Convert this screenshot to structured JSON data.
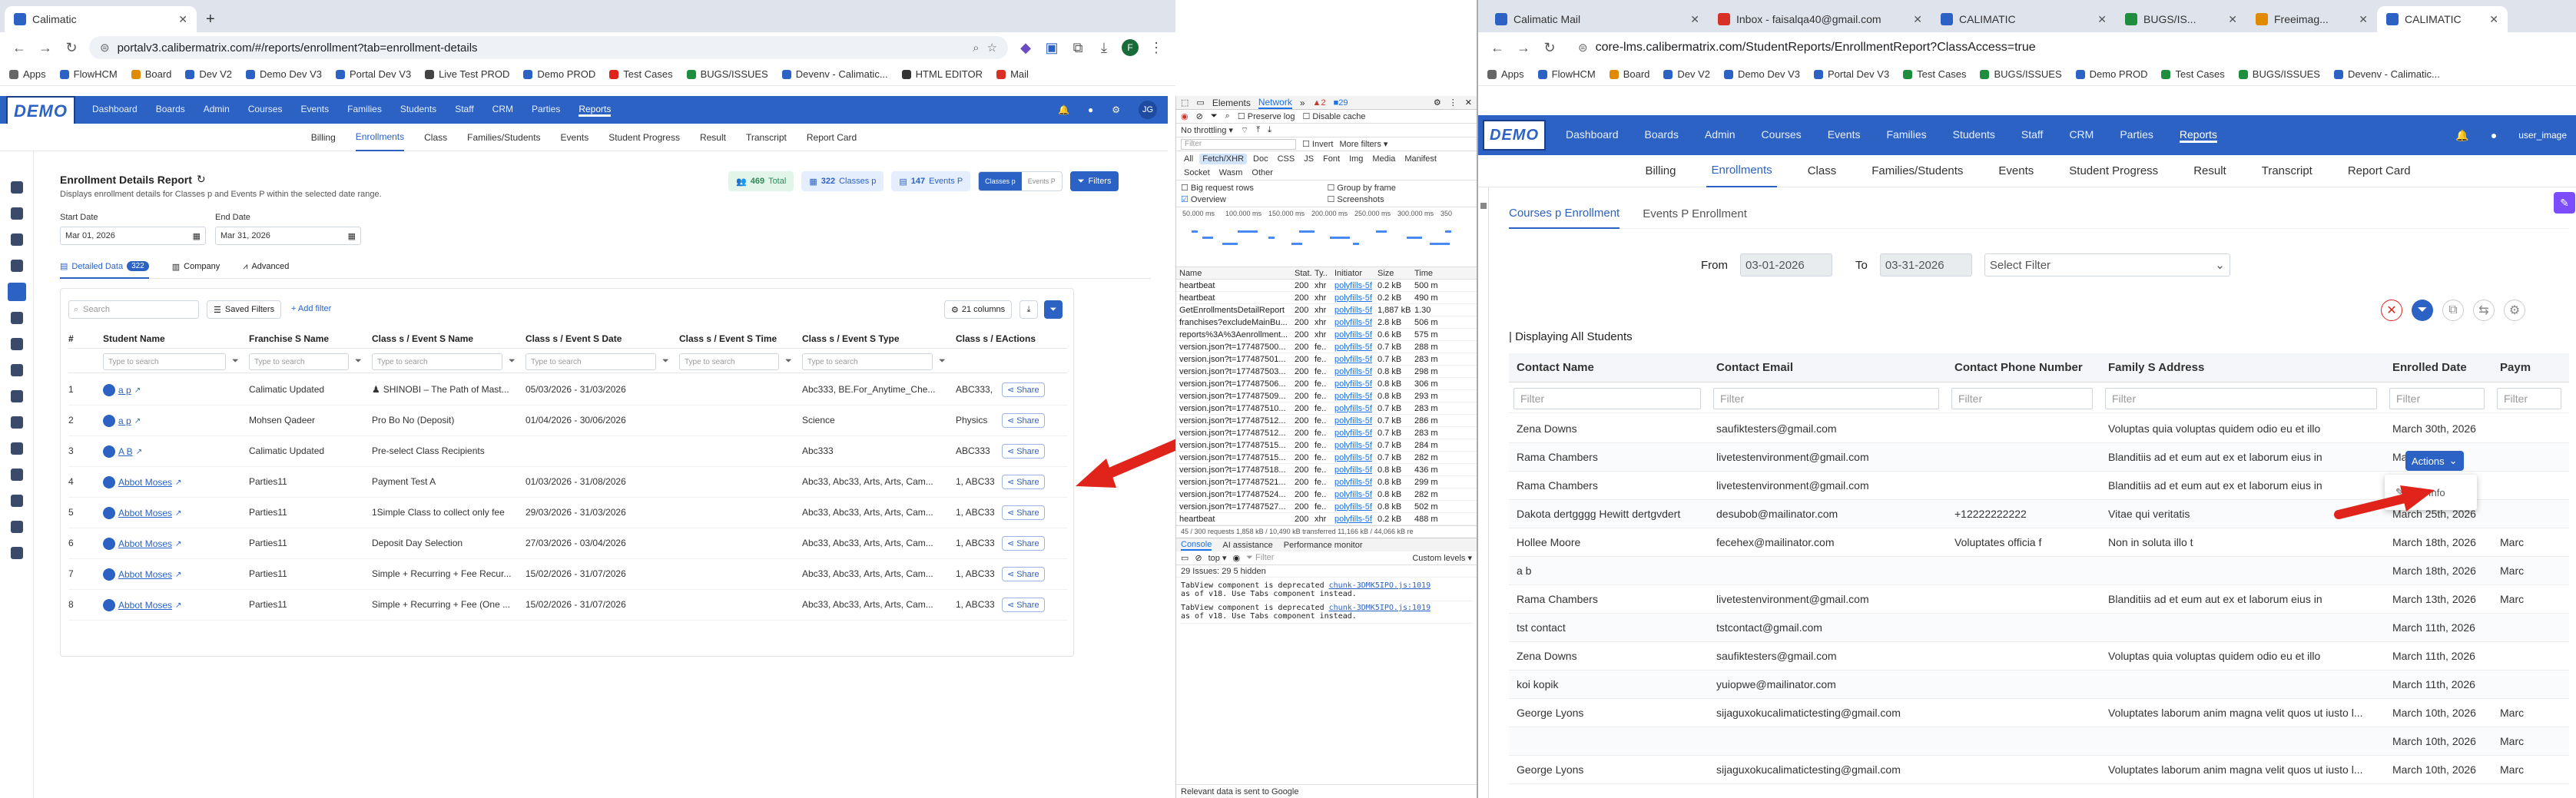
{
  "left_browser": {
    "tab_title": "Calimatic",
    "url": "portalv3.calibermatrix.com/#/reports/enrollment?tab=enrollment-details",
    "bookmarks": [
      "Apps",
      "FlowHCM",
      "Board",
      "Dev V2",
      "Demo Dev V3",
      "Portal Dev V3",
      "Live Test PROD",
      "Demo PROD",
      "Test Cases",
      "BUGS/ISSUES",
      "Devenv - Calimatic...",
      "HTML EDITOR",
      "Mail"
    ]
  },
  "left_app": {
    "logo": "DEMO",
    "nav": [
      "Dashboard",
      "Boards",
      "Admin",
      "Courses",
      "Events",
      "Families",
      "Students",
      "Staff",
      "CRM",
      "Parties",
      "Reports"
    ],
    "avatar": "JG",
    "subnav": [
      "Billing",
      "Enrollments",
      "Class",
      "Families/Students",
      "Events",
      "Student Progress",
      "Result",
      "Transcript",
      "Report Card"
    ],
    "report_title": "Enrollment Details Report",
    "report_desc": "Displays enrollment details for Classes p and Events P within the selected date range.",
    "badges": {
      "total": "469",
      "total_label": "Total",
      "classes": "322",
      "classes_label": "Classes p",
      "events": "147",
      "events_label": "Events P"
    },
    "toggle": {
      "classes": "Classes p",
      "events": "Events P"
    },
    "filters_label": "Filters",
    "start_date_label": "Start Date",
    "start_date": "Mar 01, 2026",
    "end_date_label": "End Date",
    "end_date": "Mar 31, 2026",
    "tabs": {
      "detailed": "Detailed Data",
      "detailed_count": "322",
      "company": "Company",
      "advanced": "Advanced"
    },
    "search_placeholder": "Search",
    "saved_filters": "Saved Filters",
    "add_filter": "+ Add filter",
    "columns_count": "21 columns",
    "columns": [
      "#",
      "Student Name",
      "Franchise S Name",
      "Class s / Event S Name",
      "Class s / Event S Date",
      "Class s / Event S Time",
      "Class s / Event S Type",
      "Class s / E",
      "Actions"
    ],
    "type_to_search": "Type to search",
    "share": "Share",
    "rows": [
      {
        "n": "1",
        "name": "a p",
        "fr": "Calimatic Updated",
        "ev": "SHINOBI – The Path of Mast...",
        "date": "05/03/2026 - 31/03/2026",
        "time": "",
        "type": "Abc333, BE.For_Anytime_Che...",
        "cls": "ABC333,"
      },
      {
        "n": "2",
        "name": "a p",
        "fr": "Mohsen Qadeer",
        "ev": "Pro Bo No (Deposit)",
        "date": "01/04/2026 - 30/06/2026",
        "time": "",
        "type": "Science",
        "cls": "Physics"
      },
      {
        "n": "3",
        "name": "A B",
        "fr": "Calimatic Updated",
        "ev": "Pre-select Class Recipients",
        "date": "",
        "time": "",
        "type": "Abc333",
        "cls": "ABC333"
      },
      {
        "n": "4",
        "name": "Abbot Moses",
        "fr": "Parties11",
        "ev": "Payment Test A",
        "date": "01/03/2026 - 31/08/2026",
        "time": "",
        "type": "Abc33, Abc33, Arts, Arts, Cam...",
        "cls": "1, ABC33,"
      },
      {
        "n": "5",
        "name": "Abbot Moses",
        "fr": "Parties11",
        "ev": "1Simple Class to collect only fee",
        "date": "29/03/2026 - 31/03/2026",
        "time": "",
        "type": "Abc33, Abc33, Arts, Arts, Cam...",
        "cls": "1, ABC33,"
      },
      {
        "n": "6",
        "name": "Abbot Moses",
        "fr": "Parties11",
        "ev": "Deposit Day Selection",
        "date": "27/03/2026 - 03/04/2026",
        "time": "",
        "type": "Abc33, Abc33, Arts, Arts, Cam...",
        "cls": "1, ABC33,"
      },
      {
        "n": "7",
        "name": "Abbot Moses",
        "fr": "Parties11",
        "ev": "Simple + Recurring + Fee Recur...",
        "date": "15/02/2026 - 31/07/2026",
        "time": "",
        "type": "Abc33, Abc33, Arts, Arts, Cam...",
        "cls": "1, ABC33,"
      },
      {
        "n": "8",
        "name": "Abbot Moses",
        "fr": "Parties11",
        "ev": "Simple + Recurring + Fee (One ...",
        "date": "15/02/2026 - 31/07/2026",
        "time": "",
        "type": "Abc33, Abc33, Arts, Arts, Cam...",
        "cls": "1, ABC33,"
      }
    ]
  },
  "devtools": {
    "tabs": [
      "Elements",
      "Network",
      "»"
    ],
    "counts": {
      "warn": "2",
      "errors": "29"
    },
    "options": [
      "Preserve log",
      "Disable cache"
    ],
    "throttle": "No throttling",
    "filter_placeholder": "Filter",
    "invert": "Invert",
    "more_filters": "More filters",
    "types": [
      "All",
      "Fetch/XHR",
      "Doc",
      "CSS",
      "JS",
      "Font",
      "Img",
      "Media",
      "Manifest",
      "Socket",
      "Wasm",
      "Other"
    ],
    "checks": [
      "Big request rows",
      "Group by frame",
      "Overview",
      "Screenshots"
    ],
    "timeline_ticks": [
      "50.000 ms",
      "100.000 ms",
      "150.000 ms",
      "200.000 ms",
      "250.000 ms",
      "300.000 ms",
      "350"
    ],
    "net_headers": [
      "Name",
      "Stat.",
      "Ty..",
      "Initiator",
      "Size",
      "Time"
    ],
    "net_rows": [
      {
        "name": "heartbeat",
        "st": "200",
        "ty": "xhr",
        "in": "polyfills-5f",
        "sz": "0.2 kB",
        "tm": "500 m"
      },
      {
        "name": "heartbeat",
        "st": "200",
        "ty": "xhr",
        "in": "polyfills-5f",
        "sz": "0.2 kB",
        "tm": "490 m"
      },
      {
        "name": "GetEnrollmentsDetailReport",
        "st": "200",
        "ty": "xhr",
        "in": "polyfills-5f",
        "sz": "1,887 kB",
        "tm": "1.30"
      },
      {
        "name": "franchises?excludeMainBu...",
        "st": "200",
        "ty": "xhr",
        "in": "polyfills-5f",
        "sz": "2.8 kB",
        "tm": "506 m"
      },
      {
        "name": "reports%3A%3Aenrollment...",
        "st": "200",
        "ty": "xhr",
        "in": "polyfills-5f",
        "sz": "0.6 kB",
        "tm": "575 m"
      },
      {
        "name": "version.json?t=177487500...",
        "st": "200",
        "ty": "fe..",
        "in": "polyfills-5f",
        "sz": "0.7 kB",
        "tm": "288 m"
      },
      {
        "name": "version.json?t=177487501...",
        "st": "200",
        "ty": "fe..",
        "in": "polyfills-5f",
        "sz": "0.7 kB",
        "tm": "283 m"
      },
      {
        "name": "version.json?t=177487503...",
        "st": "200",
        "ty": "fe..",
        "in": "polyfills-5f",
        "sz": "0.8 kB",
        "tm": "298 m"
      },
      {
        "name": "version.json?t=177487506...",
        "st": "200",
        "ty": "fe..",
        "in": "polyfills-5f",
        "sz": "0.8 kB",
        "tm": "306 m"
      },
      {
        "name": "version.json?t=177487509...",
        "st": "200",
        "ty": "fe..",
        "in": "polyfills-5f",
        "sz": "0.8 kB",
        "tm": "293 m"
      },
      {
        "name": "version.json?t=177487510...",
        "st": "200",
        "ty": "fe..",
        "in": "polyfills-5f",
        "sz": "0.7 kB",
        "tm": "283 m"
      },
      {
        "name": "version.json?t=177487512...",
        "st": "200",
        "ty": "fe..",
        "in": "polyfills-5f",
        "sz": "0.7 kB",
        "tm": "286 m"
      },
      {
        "name": "version.json?t=177487512...",
        "st": "200",
        "ty": "fe..",
        "in": "polyfills-5f",
        "sz": "0.7 kB",
        "tm": "283 m"
      },
      {
        "name": "version.json?t=177487515...",
        "st": "200",
        "ty": "fe..",
        "in": "polyfills-5f",
        "sz": "0.7 kB",
        "tm": "284 m"
      },
      {
        "name": "version.json?t=177487515...",
        "st": "200",
        "ty": "fe..",
        "in": "polyfills-5f",
        "sz": "0.7 kB",
        "tm": "282 m"
      },
      {
        "name": "version.json?t=177487518...",
        "st": "200",
        "ty": "fe..",
        "in": "polyfills-5f",
        "sz": "0.8 kB",
        "tm": "436 m"
      },
      {
        "name": "version.json?t=177487521...",
        "st": "200",
        "ty": "fe..",
        "in": "polyfills-5f",
        "sz": "0.8 kB",
        "tm": "299 m"
      },
      {
        "name": "version.json?t=177487524...",
        "st": "200",
        "ty": "fe..",
        "in": "polyfills-5f",
        "sz": "0.8 kB",
        "tm": "282 m"
      },
      {
        "name": "version.json?t=177487527...",
        "st": "200",
        "ty": "fe..",
        "in": "polyfills-5f",
        "sz": "0.8 kB",
        "tm": "502 m"
      },
      {
        "name": "heartbeat",
        "st": "200",
        "ty": "xhr",
        "in": "polyfills-5f",
        "sz": "0.2 kB",
        "tm": "488 m"
      }
    ],
    "summary": "45 / 300 requests  1,858 kB / 10,490 kB transferred  11,166 kB / 44,066 kB re",
    "drawer_tabs": [
      "Console",
      "AI assistance",
      "Performance monitor"
    ],
    "console_top": "top",
    "console_filter": "Filter",
    "console_level": "Custom levels",
    "issues": "29 Issues:  29  5 hidden",
    "console_lines": [
      {
        "text": "TabView component is deprecated",
        "link": "chunk-3DMK5IPO.js:1019",
        "rest": "as of v18. Use Tabs component instead."
      },
      {
        "text": "TabView component is deprecated",
        "link": "chunk-3DMK5IPO.js:1019",
        "rest": "as of v18. Use Tabs component instead."
      }
    ],
    "footer": "Relevant data is sent to Google"
  },
  "right_browser": {
    "tabs": [
      "Calimatic Mail",
      "Inbox - faisalqa40@gmail.com",
      "CALIMATIC",
      "BUGS/IS...",
      "Freeimag...",
      "CALIMATIC"
    ],
    "url": "core-lms.calibermatrix.com/StudentReports/EnrollmentReport?ClassAccess=true",
    "bookmarks": [
      "Apps",
      "FlowHCM",
      "Board",
      "Dev V2",
      "Demo Dev V3",
      "Portal Dev V3",
      "Test Cases",
      "BUGS/ISSUES",
      "Demo PROD",
      "Test Cases",
      "BUGS/ISSUES",
      "Devenv - Calimatic..."
    ]
  },
  "right_app": {
    "logo": "DEMO",
    "nav": [
      "Dashboard",
      "Boards",
      "Admin",
      "Courses",
      "Events",
      "Families",
      "Students",
      "Staff",
      "CRM",
      "Parties",
      "Reports"
    ],
    "user_image": "user_image",
    "subnav": [
      "Billing",
      "Enrollments",
      "Class",
      "Families/Students",
      "Events",
      "Student Progress",
      "Result",
      "Transcript",
      "Report Card"
    ],
    "inner_tabs": [
      "Courses p Enrollment",
      "Events P Enrollment"
    ],
    "from_label": "From",
    "from_value": "03-01-2026",
    "to_label": "To",
    "to_value": "03-31-2026",
    "select_filter": "Select Filter",
    "displaying": "| Displaying All Students",
    "columns": [
      "Contact Name",
      "Contact Email",
      "Contact Phone Number",
      "Family S Address",
      "Enrolled Date",
      "Paym"
    ],
    "filter_placeholder": "Filter",
    "actions_label": "Actions",
    "edit_info": "Edit Info",
    "rows": [
      {
        "name": "Zena Downs",
        "email": "saufiktesters@gmail.com",
        "phone": "",
        "addr": "Voluptas quia voluptas quidem odio eu et illo",
        "date": "March 30th, 2026"
      },
      {
        "name": "Rama Chambers",
        "email": "livetestenvironment@gmail.com",
        "phone": "",
        "addr": "Blanditiis ad et eum aut ex et laborum eius in",
        "date": "March 25t"
      },
      {
        "name": "Rama Chambers",
        "email": "livetestenvironment@gmail.com",
        "phone": "",
        "addr": "Blanditiis ad et eum aut ex et laborum eius in",
        "date": "Marc"
      },
      {
        "name": "Dakota dertgggg Hewitt dertgvdert",
        "email": "desubob@mailinator.com",
        "phone": "+12222222222",
        "addr": "Vitae qui veritatis",
        "date": "March 25th, 2026"
      },
      {
        "name": "Hollee Moore",
        "email": "fecehex@mailinator.com",
        "phone": "Voluptates officia f",
        "addr": "Non in soluta illo t",
        "date": "March 18th, 2026"
      },
      {
        "name": "a b",
        "email": "",
        "phone": "",
        "addr": "",
        "date": "March 18th, 2026"
      },
      {
        "name": "Rama Chambers",
        "email": "livetestenvironment@gmail.com",
        "phone": "",
        "addr": "Blanditiis ad et eum aut ex et laborum eius in",
        "date": "March 13th, 2026"
      },
      {
        "name": "tst contact",
        "email": "tstcontact@gmail.com",
        "phone": "",
        "addr": "",
        "date": "March 11th, 2026"
      },
      {
        "name": "Zena Downs",
        "email": "saufiktesters@gmail.com",
        "phone": "",
        "addr": "Voluptas quia voluptas quidem odio eu et illo",
        "date": "March 11th, 2026"
      },
      {
        "name": "koi kopik",
        "email": "yuiopwe@mailinator.com",
        "phone": "",
        "addr": "",
        "date": "March 11th, 2026"
      },
      {
        "name": "George Lyons",
        "email": "sijaguxokucalimatictesting@gmail.com",
        "phone": "",
        "addr": "Voluptates laborum anim magna velit quos ut iusto l...",
        "date": "March 10th, 2026"
      },
      {
        "name": "",
        "email": "",
        "phone": "",
        "addr": "",
        "date": "March 10th, 2026"
      },
      {
        "name": "George Lyons",
        "email": "sijaguxokucalimatictesting@gmail.com",
        "phone": "",
        "addr": "Voluptates laborum anim magna velit quos ut iusto l...",
        "date": "March 10th, 2026"
      }
    ],
    "pay_col": [
      "",
      "",
      "",
      "",
      "Marc",
      "Marc",
      "Marc",
      "",
      "",
      "",
      "Marc",
      "Marc",
      "Marc"
    ]
  },
  "colors": {
    "brand": "#2c62c4",
    "arrow": "#e0241b"
  }
}
